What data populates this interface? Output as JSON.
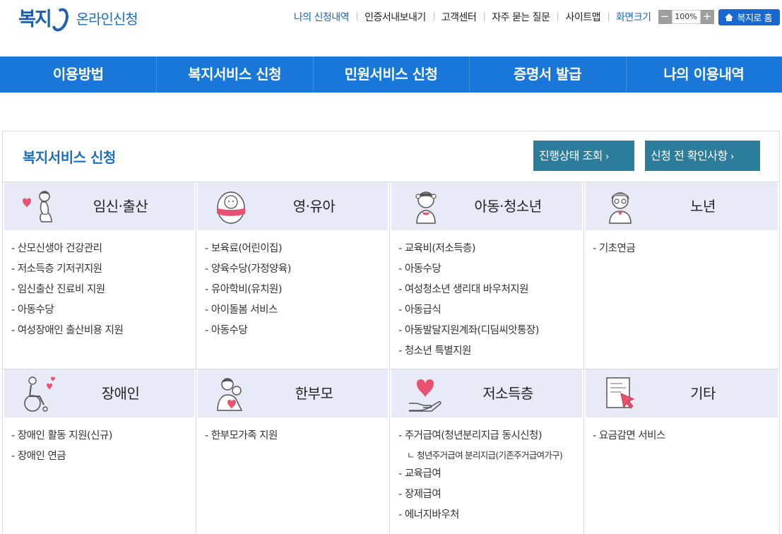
{
  "header": {
    "logo_mark": "복지",
    "logo_sub": "온라인신청",
    "util_links": [
      "나의 신청내역",
      "인증서내보내기",
      "고객센터",
      "자주 묻는 질문",
      "사이트맵"
    ],
    "zoom_label": "화면크기",
    "zoom_minus": "−",
    "zoom_value": "100%",
    "zoom_plus": "+",
    "home_button": "복지로 홈"
  },
  "nav": {
    "items": [
      "이용방법",
      "복지서비스 신청",
      "민원서비스 신청",
      "증명서 발급",
      "나의 이용내역"
    ]
  },
  "panel": {
    "title": "복지서비스 신청",
    "status_button": "진행상태 조회",
    "check_button": "신청 전 확인사항",
    "chevron": "›"
  },
  "categories": [
    {
      "name": "임신·출산",
      "icon": "pregnant-woman-icon",
      "items": [
        "- 산모신생아 건강관리",
        "- 저소득층 기저귀지원",
        "- 임신출산 진료비 지원",
        "- 아동수당",
        "- 여성장애인 출산비용 지원"
      ]
    },
    {
      "name": "영·유아",
      "icon": "baby-icon",
      "items": [
        "- 보육료(어린이집)",
        "- 양육수당(가정양육)",
        "- 유아학비(유치원)",
        "- 아이돌봄 서비스",
        "- 아동수당"
      ]
    },
    {
      "name": "아동·청소년",
      "icon": "child-icon",
      "items": [
        "- 교육비(저소득층)",
        "- 아동수당",
        "- 여성청소년 생리대 바우처지원",
        "- 아동급식",
        "- 아동발달지원계좌(디딤씨앗통장)",
        "- 청소년 특별지원"
      ]
    },
    {
      "name": "노년",
      "icon": "elderly-icon",
      "items": [
        "- 기초연금"
      ]
    },
    {
      "name": "장애인",
      "icon": "wheelchair-icon",
      "items": [
        "- 장애인 활동 지원(신규)",
        "- 장애인 연금"
      ]
    },
    {
      "name": "한부모",
      "icon": "single-parent-icon",
      "items": [
        "- 한부모가족 지원"
      ]
    },
    {
      "name": "저소득층",
      "icon": "heart-hand-icon",
      "items": [
        "- 주거급여(청년분리지급 동시신청)",
        "ㄴ 청년주거급여 분리지급(기존주거급여가구)",
        "- 교육급여",
        "- 장제급여",
        "- 에너지바우처"
      ]
    },
    {
      "name": "기타",
      "icon": "document-cursor-icon",
      "items": [
        "- 요금감면 서비스"
      ]
    }
  ],
  "colors": {
    "brand": "#1c5fb0",
    "nav": "#1877d8",
    "panel_button": "#2c7c9b",
    "category_bg": "#e8ebf7",
    "heart": "#e8516f"
  }
}
